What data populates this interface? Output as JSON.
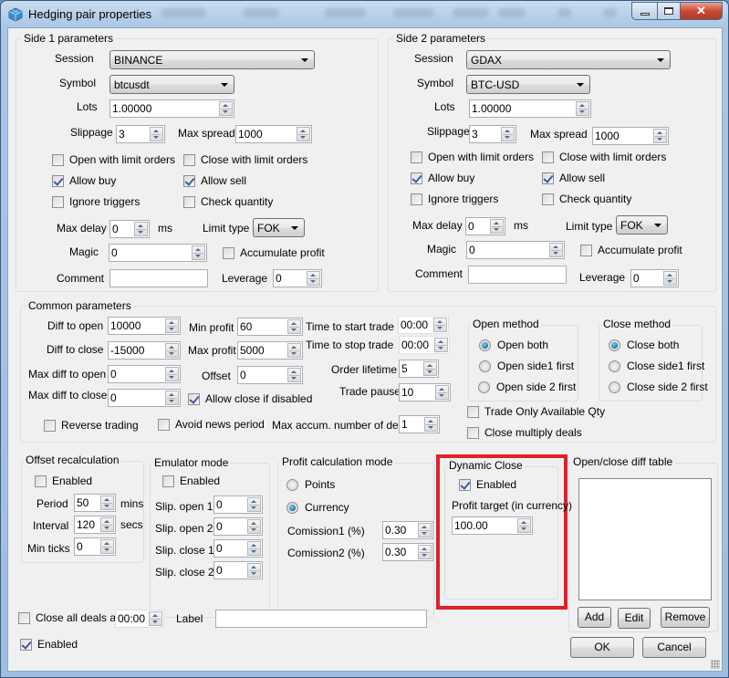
{
  "window": {
    "title": "Hedging pair properties",
    "icon": "cube-app-icon",
    "buttons": {
      "minimize": "minimize-icon",
      "maximize": "maximize-icon",
      "close": "close-icon"
    }
  },
  "side1": {
    "title": "Side 1 parameters",
    "session_label": "Session",
    "session_value": "BINANCE",
    "symbol_label": "Symbol",
    "symbol_value": "btcusdt",
    "lots_label": "Lots",
    "lots_value": "1.00000",
    "slippage_label": "Slippage",
    "slippage_value": "3",
    "max_spread_label": "Max spread",
    "max_spread_value": "1000",
    "open_limit_label": "Open with limit orders",
    "open_limit_checked": false,
    "close_limit_label": "Close with limit orders",
    "close_limit_checked": false,
    "allow_buy_label": "Allow buy",
    "allow_buy_checked": true,
    "allow_sell_label": "Allow sell",
    "allow_sell_checked": true,
    "ignore_triggers_label": "Ignore triggers",
    "ignore_triggers_checked": false,
    "check_quantity_label": "Check quantity",
    "check_quantity_checked": false,
    "max_delay_label": "Max delay",
    "max_delay_value": "0",
    "max_delay_unit": "ms",
    "limit_type_label": "Limit type",
    "limit_type_value": "FOK",
    "magic_label": "Magic",
    "magic_value": "0",
    "accumulate_label": "Accumulate profit",
    "accumulate_checked": false,
    "comment_label": "Comment",
    "comment_value": "",
    "leverage_label": "Leverage",
    "leverage_value": "0"
  },
  "side2": {
    "title": "Side 2 parameters",
    "session_label": "Session",
    "session_value": "GDAX",
    "symbol_label": "Symbol",
    "symbol_value": "BTC-USD",
    "lots_label": "Lots",
    "lots_value": "1.00000",
    "slippage_label": "Slippage",
    "slippage_value": "3",
    "max_spread_label": "Max spread",
    "max_spread_value": "1000",
    "open_limit_label": "Open with limit orders",
    "open_limit_checked": false,
    "close_limit_label": "Close with limit orders",
    "close_limit_checked": false,
    "allow_buy_label": "Allow buy",
    "allow_buy_checked": true,
    "allow_sell_label": "Allow sell",
    "allow_sell_checked": true,
    "ignore_triggers_label": "Ignore triggers",
    "ignore_triggers_checked": false,
    "check_quantity_label": "Check quantity",
    "check_quantity_checked": false,
    "max_delay_label": "Max delay",
    "max_delay_value": "0",
    "max_delay_unit": "ms",
    "limit_type_label": "Limit type",
    "limit_type_value": "FOK",
    "magic_label": "Magic",
    "magic_value": "0",
    "accumulate_label": "Accumulate profit",
    "accumulate_checked": false,
    "comment_label": "Comment",
    "comment_value": "",
    "leverage_label": "Leverage",
    "leverage_value": "0"
  },
  "common": {
    "title": "Common parameters",
    "diff_open_label": "Diff to open",
    "diff_open_value": "10000",
    "diff_close_label": "Diff to close",
    "diff_close_value": "-15000",
    "max_diff_open_label": "Max diff to open",
    "max_diff_open_value": "0",
    "max_diff_close_label": "Max diff to close",
    "max_diff_close_value": "0",
    "min_profit_label": "Min profit",
    "min_profit_value": "60",
    "max_profit_label": "Max profit",
    "max_profit_value": "5000",
    "offset_label": "Offset",
    "offset_value": "0",
    "allow_close_disabled_label": "Allow close if disabled",
    "allow_close_disabled_checked": true,
    "time_start_label": "Time to start trade",
    "time_start_value": "00:00",
    "time_stop_label": "Time to stop trade",
    "time_stop_value": "00:00",
    "order_lifetime_label": "Order lifetime",
    "order_lifetime_value": "5",
    "trade_pause_label": "Trade pause",
    "trade_pause_value": "10",
    "reverse_trading_label": "Reverse trading",
    "reverse_trading_checked": false,
    "avoid_news_label": "Avoid news period",
    "avoid_news_checked": false,
    "max_accum_label": "Max accum. number of deals",
    "max_accum_value": "1",
    "open_method": {
      "title": "Open method",
      "options": [
        "Open both",
        "Open side1 first",
        "Open side 2 first"
      ],
      "selected": "Open both"
    },
    "close_method": {
      "title": "Close method",
      "options": [
        "Close both",
        "Close side1 first",
        "Close side 2 first"
      ],
      "selected": "Close both"
    },
    "trade_only_available_label": "Trade Only Available Qty",
    "trade_only_available_checked": false,
    "close_multiply_label": "Close multiply deals",
    "close_multiply_checked": false
  },
  "offset_recalc": {
    "title": "Offset recalculation",
    "enabled_label": "Enabled",
    "enabled_checked": false,
    "period_label": "Period",
    "period_value": "50",
    "period_unit": "mins",
    "interval_label": "Interval",
    "interval_value": "120",
    "interval_unit": "secs",
    "min_ticks_label": "Min ticks",
    "min_ticks_value": "0"
  },
  "emulator": {
    "title": "Emulator mode",
    "enabled_label": "Enabled",
    "enabled_checked": false,
    "slip_open1_label": "Slip. open 1",
    "slip_open1_value": "0",
    "slip_open2_label": "Slip. open 2",
    "slip_open2_value": "0",
    "slip_close1_label": "Slip. close 1",
    "slip_close1_value": "0",
    "slip_close2_label": "Slip. close 2",
    "slip_close2_value": "0"
  },
  "profit_calc": {
    "title": "Profit calculation mode",
    "options": [
      "Points",
      "Currency"
    ],
    "selected": "Currency",
    "commission1_label": "Comission1 (%)",
    "commission1_value": "0.30",
    "commission2_label": "Comission2 (%)",
    "commission2_value": "0.30"
  },
  "dynamic_close": {
    "title": "Dynamic Close",
    "enabled_label": "Enabled",
    "enabled_checked": true,
    "profit_target_label": "Profit target (in currency)",
    "profit_target_value": "100.00",
    "highlight_color": "#e0202a"
  },
  "diff_table": {
    "title": "Open/close diff table",
    "rows": [],
    "add_label": "Add",
    "edit_label": "Edit",
    "remove_label": "Remove"
  },
  "footer": {
    "close_all_label": "Close all deals at",
    "close_all_checked": false,
    "close_all_value": "00:00",
    "label_label": "Label",
    "label_value": "",
    "enabled_label": "Enabled",
    "enabled_checked": true,
    "ok_label": "OK",
    "cancel_label": "Cancel"
  }
}
